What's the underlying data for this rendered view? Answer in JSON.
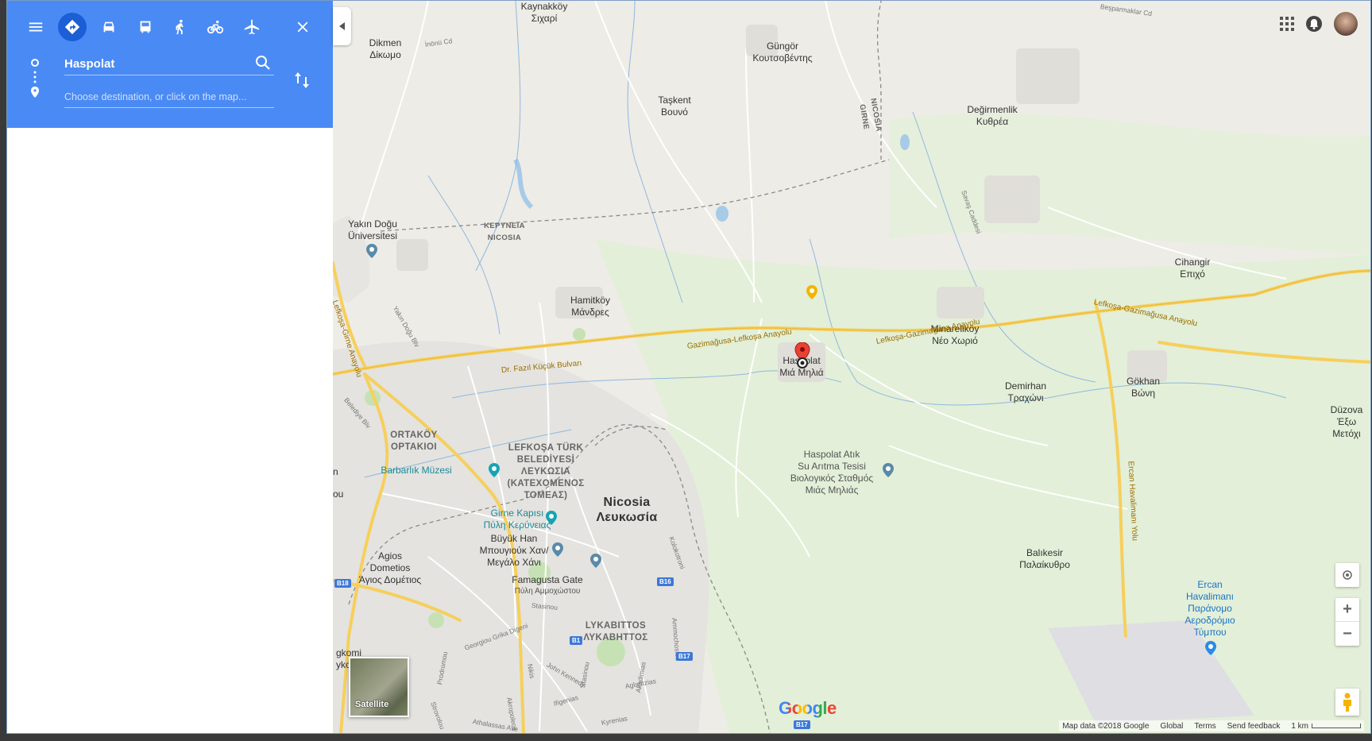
{
  "panel": {
    "origin_value": "Haspolat",
    "destination_placeholder": "Choose destination, or click on the map...",
    "modes": [
      "best-route",
      "driving",
      "transit",
      "walking",
      "cycling",
      "flights"
    ],
    "accent_color": "#4a8af4"
  },
  "map": {
    "places": [
      {
        "name": "Kaynakköy\nΣιχαρί"
      },
      {
        "name": "Dikmen\nΔίκωμο"
      },
      {
        "name": "Güngör\nΚουτσοβέντης"
      },
      {
        "name": "Taşkent\nΒουνό"
      },
      {
        "name": "Değirmenlik\nΚυθρέα"
      },
      {
        "name": "Yakın Doğu\nÜniversitesi"
      },
      {
        "name": "Hamitköy\nΜάνδρες"
      },
      {
        "name": "Haspolat\nΜιά Μηλιά"
      },
      {
        "name": "Minareliköy\nΝέο Χωριό"
      },
      {
        "name": "Cihangir\nΕπιχό"
      },
      {
        "name": "Demirhan\nΤραχώνι"
      },
      {
        "name": "Gökhan\nΒώνη"
      },
      {
        "name": "Düzova\nΈξω Μετόχι"
      },
      {
        "name": "Balıkesir\nΠαλαίκυθρο"
      },
      {
        "name": "Agios\nDometios\nΆγιος Δομέτιος"
      },
      {
        "name": "Famagusta Gate"
      },
      {
        "name": "Πύλη Αμμοχώστου"
      }
    ],
    "caps_labels": [
      {
        "name": "KEΡΥΝΕΙΑ\nNICOSIA"
      },
      {
        "name": "NICOSIA\nGIRNE"
      },
      {
        "name": "ORTAKÖY\nΟΡΤΑΚΙΟΙ"
      },
      {
        "name": "LEFKOŞA TÜRK\nBELEDİYESİ\nΛΕΥΚΩΣΙΑ\n(ΚΑΤΕΧΟΜΕΝΟΣ\nΤΟΜΕΑΣ)"
      },
      {
        "name": "LYKABITTOS\nΛΥΚΑΒΗΤΤΟΣ"
      }
    ],
    "city": {
      "name": "Nicosia\nΛευκωσία"
    },
    "pois": [
      {
        "name": "Barbarlık Müzesi"
      },
      {
        "name": "Girne Kapısı\nΠύλη Κερύνειας"
      },
      {
        "name": "Büyük Han\nΜπουγιούκ Χαν/\nΜεγάλο Χάνι"
      },
      {
        "name": "Haspolat Atık\nSu Arıtma Tesisi\nΒιολογικός Σταθμός\nΜιάς Μηλιάς"
      },
      {
        "name": "Ercan\nHavalimanı\nΠαράνομο\nΑεροδρόμιο\nΤύμπου"
      }
    ],
    "roads": [
      {
        "name": "Dr. Fazıl Küçük Bulvarı"
      },
      {
        "name": "Gazimağusa-Lefkoşa Anayolu"
      },
      {
        "name": "Lefkoşa-Gazimağusa Anayolu"
      },
      {
        "name": "Lefkoşa-Gazimağusa Anayolu"
      },
      {
        "name": "Ercan Havalimanı Yolu"
      },
      {
        "name": "Lefkoşa-Girne Anayolu"
      }
    ],
    "minor_roads": [
      {
        "name": "İnönü Cd"
      },
      {
        "name": "Yakın Doğu Blv"
      },
      {
        "name": "Belediye Blv"
      },
      {
        "name": "Kolokotroni"
      },
      {
        "name": "Ammochostou"
      },
      {
        "name": "Stasinou"
      },
      {
        "name": "Georgiou Grika Digeni"
      },
      {
        "name": "Prodromou"
      },
      {
        "name": "Nikis"
      },
      {
        "name": "John Kennedy"
      },
      {
        "name": "Aglantzias"
      },
      {
        "name": "Ifigenias"
      },
      {
        "name": "Akropoleos"
      },
      {
        "name": "Stasinou"
      },
      {
        "name": "Akadimias"
      },
      {
        "name": "Athalassas Ave"
      },
      {
        "name": "Kyrenias"
      },
      {
        "name": "Strovolou"
      },
      {
        "name": "Savaş Caddesi"
      },
      {
        "name": "Beşparmaklar Cd"
      }
    ],
    "shields": [
      {
        "name": "B18"
      },
      {
        "name": "B16"
      },
      {
        "name": "B1"
      },
      {
        "name": "B17"
      },
      {
        "name": "B17"
      }
    ],
    "edge_labels": [
      {
        "name": "gkomi\nykou"
      },
      {
        "name": "n"
      },
      {
        "name": "ou"
      }
    ],
    "satellite_label": "Satellite",
    "logo": "Google",
    "footer": {
      "map_data": "Map data ©2018 Google",
      "region": "Global",
      "terms": "Terms",
      "feedback": "Send feedback",
      "scale": "1 km"
    }
  }
}
